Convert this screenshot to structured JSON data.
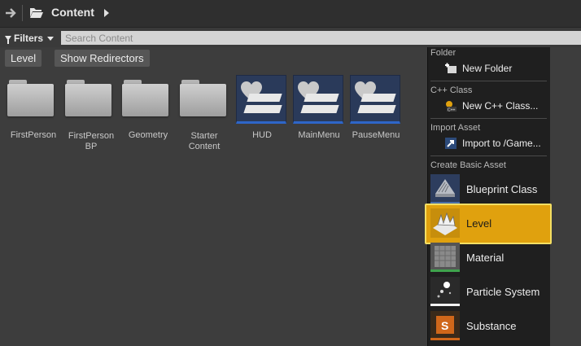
{
  "header": {
    "back_icon": "arrow-right-icon",
    "folder_icon": "folder-open-icon",
    "title": "Content",
    "chevron_icon": "chevron-right-icon"
  },
  "toolbar": {
    "filters_label": "Filters",
    "search_placeholder": "Search Content"
  },
  "chips": [
    {
      "label": "Level"
    },
    {
      "label": "Show Redirectors"
    }
  ],
  "assets": [
    {
      "label": "FirstPerson",
      "kind": "folder"
    },
    {
      "label": "FirstPerson BP",
      "kind": "folder"
    },
    {
      "label": "Geometry",
      "kind": "folder"
    },
    {
      "label": "Starter Content",
      "kind": "folder"
    },
    {
      "label": "HUD",
      "kind": "widget"
    },
    {
      "label": "MainMenu",
      "kind": "widget"
    },
    {
      "label": "PauseMenu",
      "kind": "widget"
    }
  ],
  "context_menu": {
    "sections": [
      {
        "title": "Folder",
        "items": [
          {
            "label": "New Folder",
            "icon": "new-folder-icon"
          }
        ]
      },
      {
        "title": "C++ Class",
        "items": [
          {
            "label": "New C++ Class...",
            "icon": "cpp-class-icon"
          }
        ]
      },
      {
        "title": "Import Asset",
        "items": [
          {
            "label": "Import to /Game...",
            "icon": "import-icon"
          }
        ]
      },
      {
        "title": "Create Basic Asset",
        "items": [
          {
            "label": "Blueprint Class",
            "icon": "blueprint-icon",
            "accent": "#4a6fa8"
          },
          {
            "label": "Level",
            "icon": "level-icon",
            "accent": "#e0a10e",
            "selected": true
          },
          {
            "label": "Material",
            "icon": "material-icon",
            "accent": "#3fa34d"
          },
          {
            "label": "Particle System",
            "icon": "particle-icon",
            "accent": "#ffffff"
          },
          {
            "label": "Substance",
            "icon": "substance-icon",
            "accent": "#d0671a"
          }
        ]
      }
    ]
  },
  "colors": {
    "selection_fill": "#e0a10e",
    "selection_border": "#f4df63",
    "widget_accent": "#2e66c8"
  }
}
